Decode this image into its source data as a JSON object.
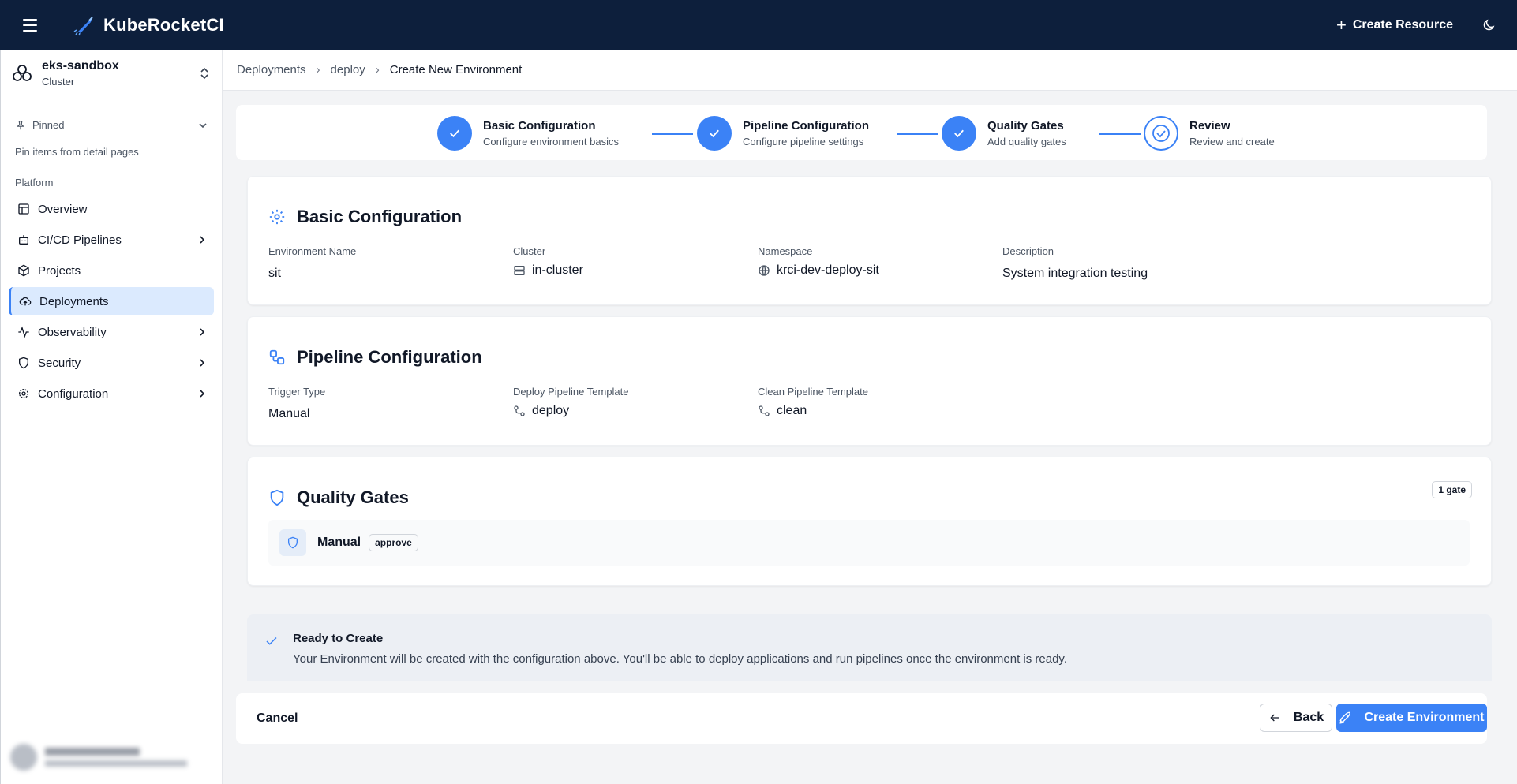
{
  "app": {
    "name": "KubeRocketCI",
    "create_resource_label": "Create Resource"
  },
  "sidebar": {
    "cluster_name": "eks-sandbox",
    "cluster_type": "Cluster",
    "pinned_label": "Pinned",
    "pinned_hint": "Pin items from detail pages",
    "section_label": "Platform",
    "items": [
      {
        "label": "Overview",
        "icon": "table-icon",
        "has_submenu": false,
        "active": false
      },
      {
        "label": "CI/CD Pipelines",
        "icon": "bot-icon",
        "has_submenu": true,
        "active": false
      },
      {
        "label": "Projects",
        "icon": "cube-icon",
        "has_submenu": false,
        "active": false
      },
      {
        "label": "Deployments",
        "icon": "cloud-upload-icon",
        "has_submenu": false,
        "active": true
      },
      {
        "label": "Observability",
        "icon": "activity-icon",
        "has_submenu": true,
        "active": false
      },
      {
        "label": "Security",
        "icon": "shield-icon",
        "has_submenu": true,
        "active": false
      },
      {
        "label": "Configuration",
        "icon": "gear-icon",
        "has_submenu": true,
        "active": false
      }
    ]
  },
  "breadcrumb": {
    "items": [
      "Deployments",
      "deploy"
    ],
    "current": "Create New Environment"
  },
  "stepper": {
    "steps": [
      {
        "title": "Basic Configuration",
        "subtitle": "Configure environment basics",
        "state": "complete"
      },
      {
        "title": "Pipeline Configuration",
        "subtitle": "Configure pipeline settings",
        "state": "complete"
      },
      {
        "title": "Quality Gates",
        "subtitle": "Add quality gates",
        "state": "complete"
      },
      {
        "title": "Review",
        "subtitle": "Review and create",
        "state": "current"
      }
    ]
  },
  "basic": {
    "title": "Basic Configuration",
    "env_name_label": "Environment Name",
    "env_name": "sit",
    "cluster_label": "Cluster",
    "cluster": "in-cluster",
    "namespace_label": "Namespace",
    "namespace": "krci-dev-deploy-sit",
    "description_label": "Description",
    "description": "System integration testing"
  },
  "pipeline": {
    "title": "Pipeline Configuration",
    "trigger_label": "Trigger Type",
    "trigger": "Manual",
    "deploy_label": "Deploy Pipeline Template",
    "deploy": "deploy",
    "clean_label": "Clean Pipeline Template",
    "clean": "clean"
  },
  "gates": {
    "title": "Quality Gates",
    "count_badge": "1 gate",
    "items": [
      {
        "name": "Manual",
        "tag": "approve"
      }
    ]
  },
  "ready": {
    "title": "Ready to Create",
    "description": "Your Environment will be created with the configuration above. You'll be able to deploy applications and run pipelines once the environment is ready."
  },
  "footer": {
    "cancel_label": "Cancel",
    "back_label": "Back",
    "create_label": "Create Environment"
  },
  "colors": {
    "topbar": "#0d1f3c",
    "accent": "#3b82f6",
    "active_nav": "#dbeafe"
  }
}
